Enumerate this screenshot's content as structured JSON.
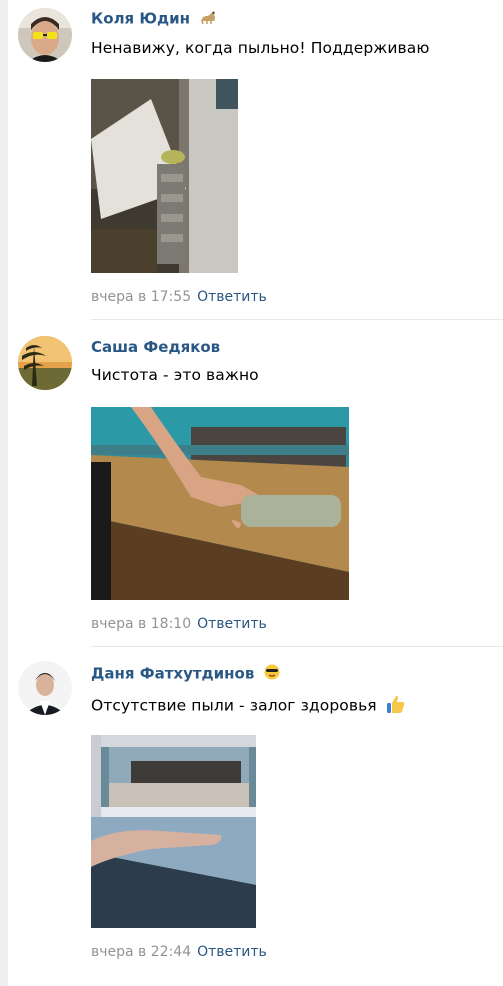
{
  "comments": [
    {
      "author": "Коля Юдин",
      "author_emoji": "cat-emoji",
      "text": "Ненавижу, когда пыльно! Поддерживаю",
      "text_emoji": "",
      "photo_description_icon": "photo-radiator",
      "date": "вчера в 17:55",
      "reply_label": "Ответить"
    },
    {
      "author": "Саша Федяков",
      "author_emoji": "",
      "text": "Чистота - это важно",
      "text_emoji": "",
      "photo_description_icon": "photo-table",
      "date": "вчера в 18:10",
      "reply_label": "Ответить"
    },
    {
      "author": "Даня Фатхутдинов",
      "author_emoji": "sunglasses-emoji",
      "text": "Отсутствие пыли - залог здоровья",
      "text_emoji": "thumbs-up-emoji",
      "photo_description_icon": "photo-windowsill",
      "date": "вчера в 22:44",
      "reply_label": "Ответить"
    }
  ],
  "colors": {
    "link": "#2a5885",
    "meta": "#939393",
    "background": "#edeef0"
  }
}
